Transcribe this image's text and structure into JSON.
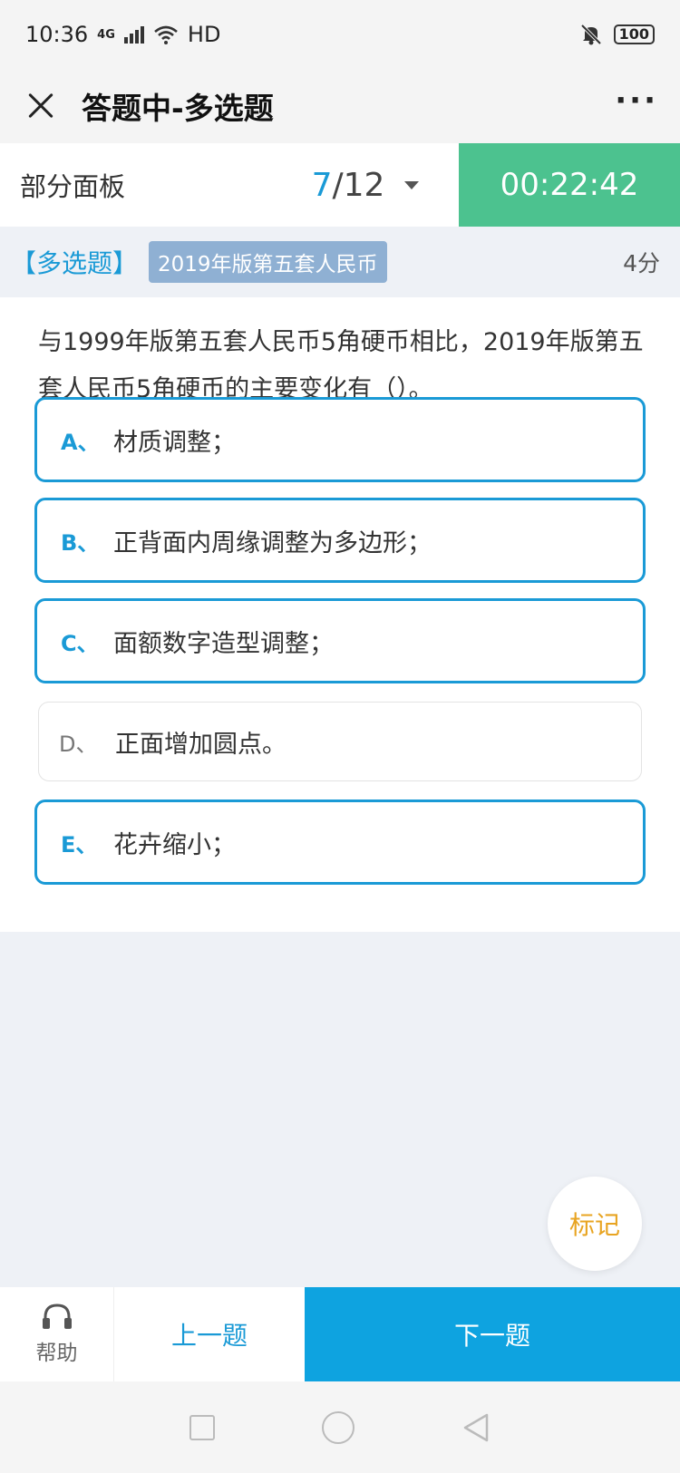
{
  "status_bar": {
    "time": "10:36",
    "network": "4G",
    "hd": "HD",
    "battery": "100",
    "icons": [
      "signal-icon",
      "wifi-icon",
      "mute-icon",
      "battery-icon"
    ]
  },
  "title_bar": {
    "title": "答题中-多选题",
    "more": "···"
  },
  "panel": {
    "label": "部分面板",
    "current": "7",
    "total": "/12",
    "timer": "00:22:42"
  },
  "question": {
    "type_label": "【多选题】",
    "tag": "2019年版第五套人民币",
    "score": "4分",
    "text": "与1999年版第五套人民币5角硬币相比，2019年版第五套人民币5角硬币的主要变化有（）。",
    "options": [
      {
        "letter": "A、",
        "text": "材质调整；",
        "selected": true
      },
      {
        "letter": "B、",
        "text": "正背面内周缘调整为多边形；",
        "selected": true
      },
      {
        "letter": "C、",
        "text": "面额数字造型调整；",
        "selected": true
      },
      {
        "letter": "D、",
        "text": "正面增加圆点。",
        "selected": false
      },
      {
        "letter": "E、",
        "text": "花卉缩小；",
        "selected": true
      }
    ]
  },
  "mark_label": "标记",
  "bottom": {
    "help_label": "帮助",
    "prev_label": "上一题",
    "next_label": "下一题"
  },
  "colors": {
    "accent": "#1a9ad6",
    "timer_bg": "#4cc28f",
    "next_bg": "#0ea3e0",
    "mark": "#e8a421",
    "tag_bg": "#8fb0d3"
  }
}
